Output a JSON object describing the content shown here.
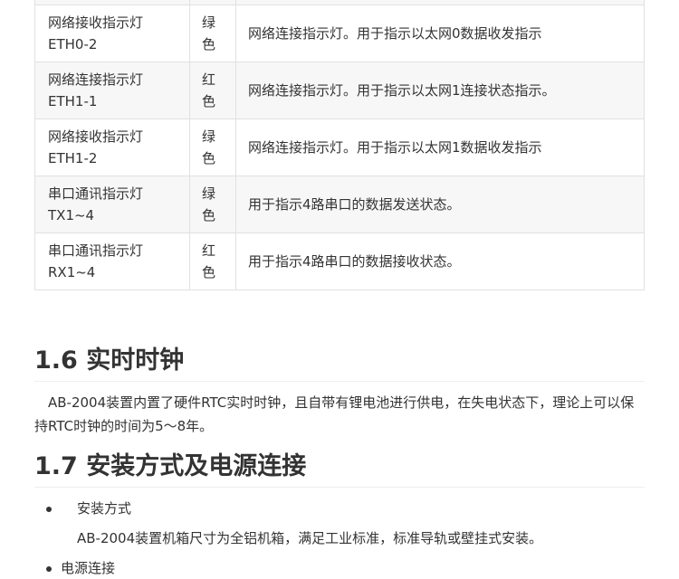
{
  "table": {
    "rows": [
      {
        "name_l1": "",
        "name_l2": "",
        "color_l1": "",
        "color_l2": "",
        "desc": ""
      },
      {
        "name_l1": "网络接收指示灯",
        "name_l2": "ETH0-2",
        "color_l1": "绿",
        "color_l2": "色",
        "desc": "网络连接指示灯。用于指示以太网0数据收发指示"
      },
      {
        "name_l1": "网络连接指示灯",
        "name_l2": "ETH1-1",
        "color_l1": "红",
        "color_l2": "色",
        "desc": "网络连接指示灯。用于指示以太网1连接状态指示。"
      },
      {
        "name_l1": "网络接收指示灯",
        "name_l2": "ETH1-2",
        "color_l1": "绿",
        "color_l2": "色",
        "desc": "网络连接指示灯。用于指示以太网1数据收发指示"
      },
      {
        "name_l1": "串口通讯指示灯",
        "name_l2": "TX1~4",
        "color_l1": "绿",
        "color_l2": "色",
        "desc": "用于指示4路串口的数据发送状态。"
      },
      {
        "name_l1": "串口通讯指示灯",
        "name_l2": "RX1~4",
        "color_l1": "红",
        "color_l2": "色",
        "desc": "用于指示4路串口的数据接收状态。"
      }
    ]
  },
  "section_16": {
    "heading": "1.6 实时时钟",
    "paragraph": "AB-2004装置内置了硬件RTC实时时钟，且自带有锂电池进行供电，在失电状态下，理论上可以保持RTC时钟的时间为5～8年。"
  },
  "section_17": {
    "heading": "1.7 安装方式及电源连接",
    "bullet1": "安装方式",
    "bullet1_text": "AB-2004装置机箱尺寸为全铝机箱，满足工业标准，标准导轨或壁挂式安装。",
    "bullet2": "电源连接"
  }
}
